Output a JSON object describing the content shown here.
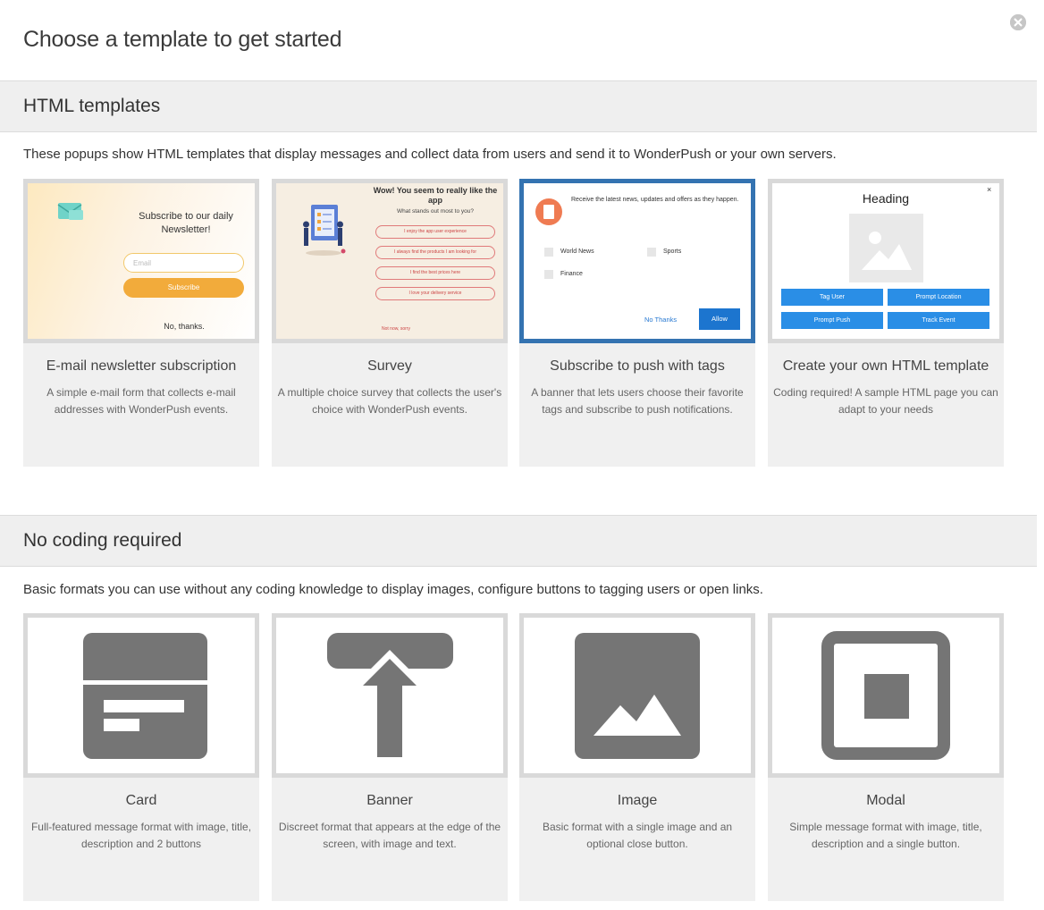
{
  "dialog": {
    "title": "Choose a template to get started",
    "close_icon": "close-circle-icon"
  },
  "html_section": {
    "title": "HTML templates",
    "description": "These popups show HTML templates that display messages and collect data from users and send it to WonderPush or your own servers.",
    "cards": [
      {
        "title": "E-mail newsletter subscription",
        "description": "A simple e-mail form that collects e-mail addresses with WonderPush events.",
        "preview": {
          "headline": "Subscribe to our daily Newsletter!",
          "email_placeholder": "Email",
          "subscribe": "Subscribe",
          "no_thanks": "No, thanks."
        }
      },
      {
        "title": "Survey",
        "description": "A multiple choice survey that collects the user's choice with WonderPush events.",
        "preview": {
          "headline": "Wow! You seem to really like the app",
          "question": "What stands out most to you?",
          "options": [
            "I enjoy the app user experience",
            "I always find the products I am looking for",
            "I find the best prices here",
            "I love your delivery service"
          ],
          "link": "Not now, sorry"
        }
      },
      {
        "title": "Subscribe to push with tags",
        "description": "A banner that lets users choose their favorite tags and subscribe to push notifications.",
        "selected": true,
        "preview": {
          "text": "Receive the latest news, updates and offers as they happen.",
          "tags": [
            "World News",
            "Sports",
            "Finance"
          ],
          "no_thanks": "No Thanks",
          "allow": "Allow"
        }
      },
      {
        "title": "Create your own HTML template",
        "description": "Coding required! A sample HTML page you can adapt to your needs",
        "preview": {
          "heading": "Heading",
          "close": "×",
          "buttons": [
            "Tag User",
            "Prompt Location",
            "Prompt Push",
            "Track Event"
          ]
        }
      }
    ]
  },
  "basic_section": {
    "title": "No coding required",
    "description": "Basic formats you can use without any coding knowledge to display images, configure buttons to tagging users or open links.",
    "cards": [
      {
        "title": "Card",
        "description": "Full-featured message format with image, title, description and 2 buttons",
        "icon": "card-format-icon"
      },
      {
        "title": "Banner",
        "description": "Discreet format that appears at the edge of the screen, with image and text.",
        "icon": "banner-format-icon"
      },
      {
        "title": "Image",
        "description": "Basic format with a single image and an optional close button.",
        "icon": "image-format-icon"
      },
      {
        "title": "Modal",
        "description": "Simple message format with image, title, description and a single button.",
        "icon": "modal-format-icon"
      }
    ]
  },
  "colors": {
    "selected_border": "#3473b1",
    "icon_gray": "#757575",
    "section_bg": "#efefef"
  }
}
